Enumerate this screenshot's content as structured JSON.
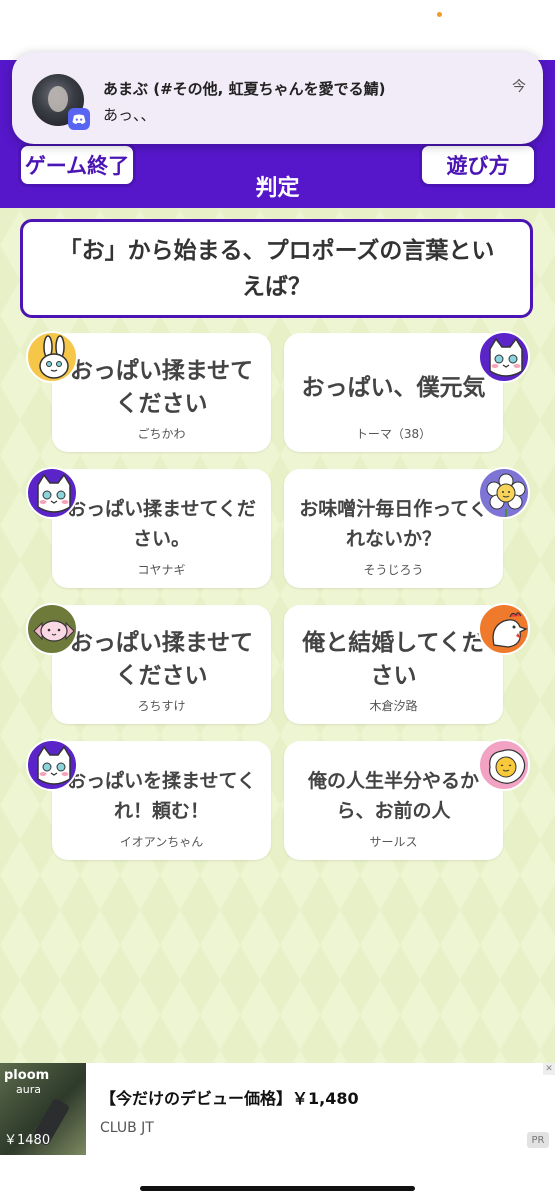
{
  "notification": {
    "title": "あまぶ (#その他, 虹夏ちゃんを愛でる鯖)",
    "body": "あっ、、",
    "time": "今"
  },
  "header": {
    "end_game_label": "ゲーム終了",
    "how_to_play_label": "遊び方",
    "judge_label": "判定"
  },
  "question": {
    "text": "「お」から始まる、プロポーズの言葉といえば？"
  },
  "answers": [
    {
      "text": "おっぱい揉ませてください",
      "author": "ごちかわ",
      "avatar": "rabbit-icon"
    },
    {
      "text": "おっぱい、僕元気",
      "author": "トーマ（38）",
      "avatar": "cat-icon"
    },
    {
      "text": "おっぱい揉ませてください。",
      "author": "コヤナギ",
      "avatar": "cat-icon"
    },
    {
      "text": "お味噌汁毎日作ってくれないか？",
      "author": "そうじろう",
      "avatar": "flower-icon"
    },
    {
      "text": "おっぱい揉ませてください",
      "author": "ろちすけ",
      "avatar": "candy-icon"
    },
    {
      "text": "俺と結婚してください",
      "author": "木倉汐路",
      "avatar": "bird-icon"
    },
    {
      "text": "おっぱいを揉ませてくれ！頼む！",
      "author": "イオアンちゃん",
      "avatar": "cat-icon"
    },
    {
      "text": "俺の人生半分やるから、お前の人",
      "author": "サールス",
      "avatar": "egg-icon"
    }
  ],
  "ad": {
    "title": "【今だけのデビュー価格】￥1,480",
    "advertiser": "CLUB JT",
    "pr_label": "PR",
    "image_brand": "ploom",
    "image_brand_sub": "aura",
    "image_price": "￥1480"
  },
  "colors": {
    "header_purple": "#5517c9",
    "border_purple": "#4b14b4",
    "background": "#eef5d2",
    "discord": "#5865f2"
  }
}
